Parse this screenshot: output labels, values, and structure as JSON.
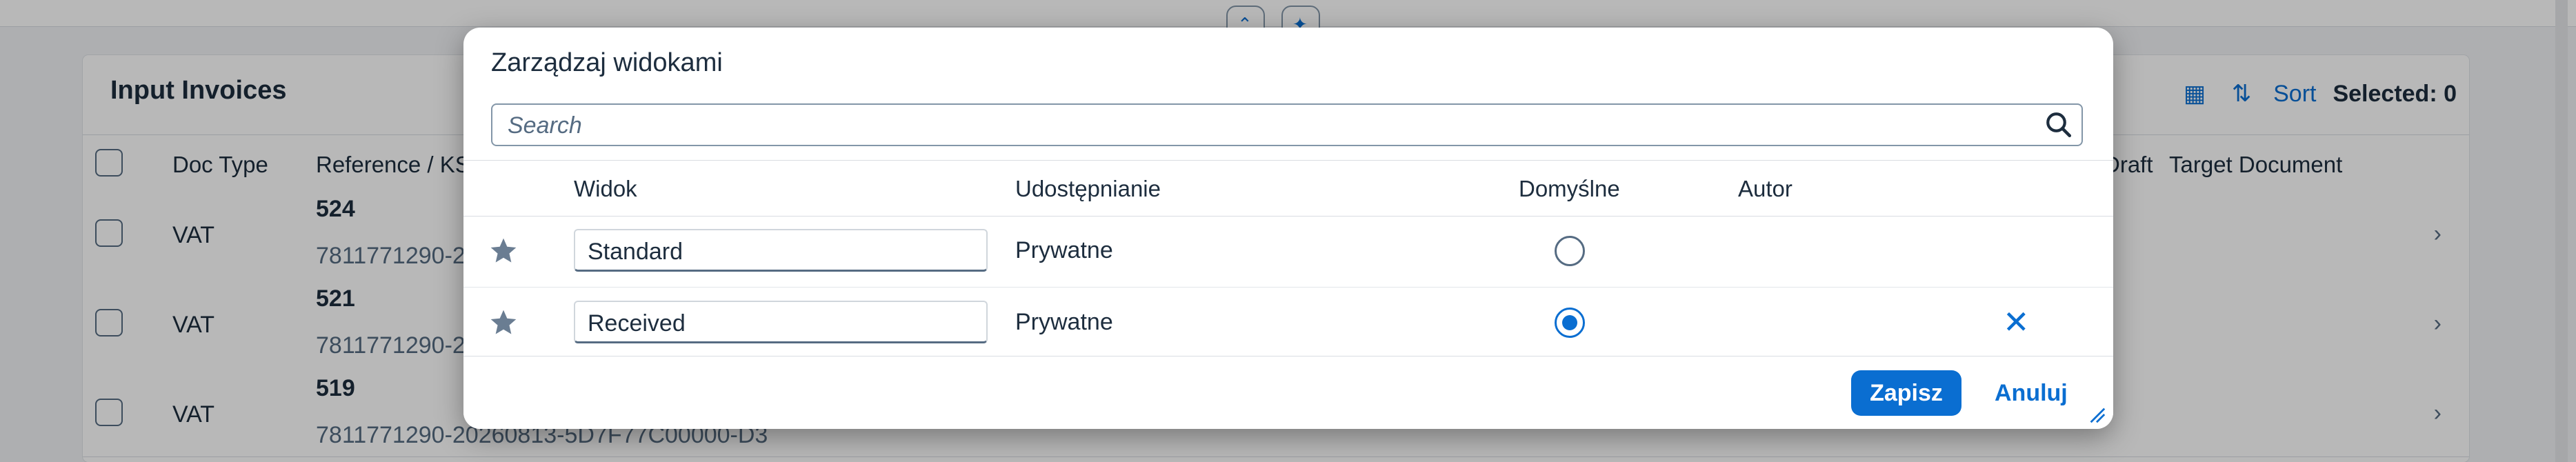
{
  "page": {
    "title": "Input Invoices",
    "toolbar": {
      "sort_label": "Sort",
      "selected_label": "Selected: 0"
    },
    "columns": [
      "Doc Type",
      "Reference / KSeF",
      "Draft",
      "Target Document"
    ],
    "rows": [
      {
        "doc_type": "VAT",
        "number": "524",
        "reference": "7811771290-2"
      },
      {
        "doc_type": "VAT",
        "number": "521",
        "reference": "7811771290-2"
      },
      {
        "doc_type": "VAT",
        "number": "519",
        "reference": "7811771290-20260813-5D7F77C00000-D3"
      }
    ]
  },
  "dialog": {
    "title": "Zarządzaj widokami",
    "search_placeholder": "Search",
    "columns": {
      "view": "Widok",
      "sharing": "Udostępnianie",
      "default": "Domyślne",
      "author": "Autor"
    },
    "views": [
      {
        "name": "Standard",
        "sharing": "Prywatne",
        "default": false,
        "deletable": false
      },
      {
        "name": "Received",
        "sharing": "Prywatne",
        "default": true,
        "deletable": true
      }
    ],
    "save_label": "Zapisz",
    "cancel_label": "Anuluj"
  },
  "colors": {
    "accent": "#0a6ed1",
    "text": "#1d2d3e"
  }
}
